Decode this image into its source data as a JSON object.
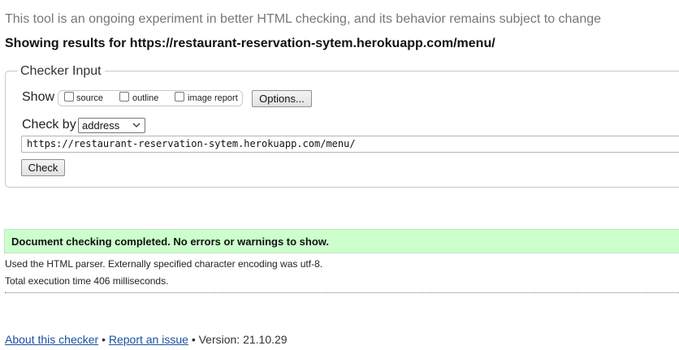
{
  "header": {
    "experiment_note": "This tool is an ongoing experiment in better HTML checking, and its behavior remains subject to change",
    "results_heading": "Showing results for https://restaurant-reservation-sytem.herokuapp.com/menu/"
  },
  "checker_input": {
    "legend": "Checker Input",
    "show_label": "Show",
    "show_options": [
      {
        "label": "source",
        "checked": false
      },
      {
        "label": "outline",
        "checked": false
      },
      {
        "label": "image report",
        "checked": false
      }
    ],
    "options_button": "Options...",
    "check_by_label": "Check by",
    "check_by_selected": "address",
    "url_value": "https://restaurant-reservation-sytem.herokuapp.com/menu/",
    "check_button": "Check"
  },
  "results": {
    "success_message": "Document checking completed. No errors or warnings to show.",
    "parser_info": "Used the HTML parser. Externally specified character encoding was utf-8.",
    "execution_time": "Total execution time 406 milliseconds."
  },
  "footer": {
    "about_link": "About this checker",
    "separator": "•",
    "report_link": "Report an issue",
    "version": "Version: 21.10.29"
  }
}
